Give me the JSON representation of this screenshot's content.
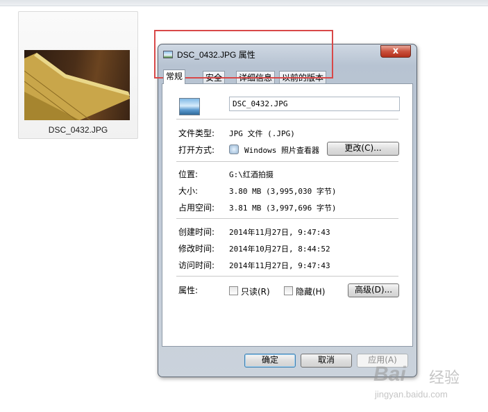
{
  "explorer": {
    "file_name": "DSC_0432.JPG"
  },
  "dialog": {
    "title": "DSC_0432.JPG 属性",
    "close_glyph": "x",
    "tabs": [
      "常规",
      "安全",
      "详细信息",
      "以前的版本"
    ],
    "file_name_value": "DSC_0432.JPG",
    "rows": {
      "type_label": "文件类型:",
      "type_value": "JPG 文件 (.JPG)",
      "opens_label": "打开方式:",
      "opens_value": "Windows 照片查看器",
      "change_button": "更改(C)...",
      "location_label": "位置:",
      "location_value": "G:\\红酒拍摄",
      "size_label": "大小:",
      "size_value": "3.80 MB (3,995,030 字节)",
      "disk_label": "占用空间:",
      "disk_value": "3.81 MB (3,997,696 字节)",
      "created_label": "创建时间:",
      "created_value": "2014年11月27日, 9:47:43",
      "modified_label": "修改时间:",
      "modified_value": "2014年10月27日, 8:44:52",
      "accessed_label": "访问时间:",
      "accessed_value": "2014年11月27日, 9:47:43",
      "attributes_label": "属性:",
      "readonly_label": "只读(R)",
      "hidden_label": "隐藏(H)",
      "advanced_button": "高级(D)..."
    },
    "buttons": {
      "ok": "确定",
      "cancel": "取消",
      "apply": "应用(A)"
    }
  },
  "watermark": {
    "logo": "Bai",
    "text": "经验",
    "url": "jingyan.baidu.com"
  },
  "colors": {
    "highlight": "#d84848",
    "close_button": "#c9503c"
  }
}
